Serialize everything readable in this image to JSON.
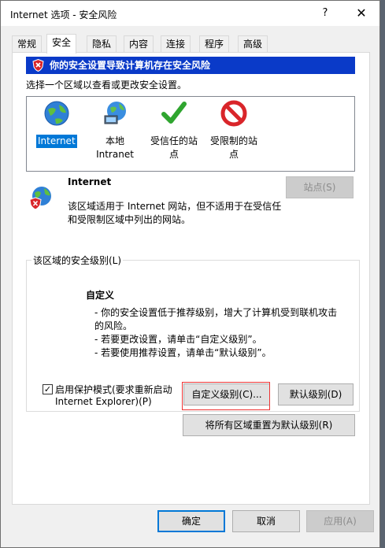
{
  "window": {
    "title": "Internet 选项 - 安全风险",
    "help_glyph": "?",
    "close_glyph": "✕"
  },
  "tabs": [
    {
      "label": "常规"
    },
    {
      "label": "安全"
    },
    {
      "label": "隐私"
    },
    {
      "label": "内容"
    },
    {
      "label": "连接"
    },
    {
      "label": "程序"
    },
    {
      "label": "高级"
    }
  ],
  "security": {
    "warning": "你的安全设置导致计算机存在安全风险",
    "select_zone_text": "选择一个区域以查看或更改安全设置。",
    "zones": [
      {
        "line1": "Internet",
        "line2": ""
      },
      {
        "line1": "本地",
        "line2": "Intranet"
      },
      {
        "line1": "受信任的站",
        "line2": "点"
      },
      {
        "line1": "受限制的站",
        "line2": "点"
      }
    ],
    "zone_info": {
      "title": "Internet",
      "desc_line1": "该区域适用于 Internet 网站，但不适用于在受信任",
      "desc_line2": "和受限制区域中列出的网站。",
      "sites_button": "站点(S)"
    },
    "level_group": {
      "title": "该区域的安全级别(L)",
      "level_name": "自定义",
      "bullet1_line1": "- 你的安全设置低于推荐级别，增大了计算机受到联机攻击",
      "bullet1_line2": "的风险。",
      "bullet2": "- 若要更改设置，请单击“自定义级别”。",
      "bullet3": "- 若要使用推荐设置，请单击“默认级别”。"
    },
    "protected_mode": {
      "checked": true,
      "check_glyph": "✓",
      "line1": "启用保护模式(要求重新启动",
      "line2": "Internet Explorer)(P)"
    },
    "custom_level_button": "自定义级别(C)...",
    "default_level_button": "默认级别(D)",
    "reset_all_button": "将所有区域重置为默认级别(R)"
  },
  "footer": {
    "ok": "确定",
    "cancel": "取消",
    "apply": "应用(A)"
  },
  "colors": {
    "warning_bar": "#0a3ac8",
    "selection": "#0078d7",
    "highlight_box": "#e33333"
  }
}
